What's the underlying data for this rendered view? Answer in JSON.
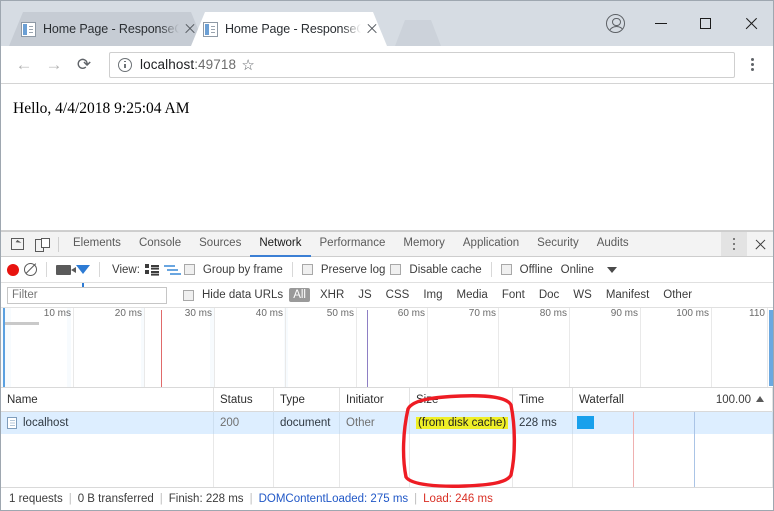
{
  "browser": {
    "tabs": [
      {
        "title": "Home Page - ResponseC",
        "active": false
      },
      {
        "title": "Home Page - ResponseC",
        "active": true
      }
    ],
    "window_controls": {
      "profile": "profile-avatar",
      "minimize": "—",
      "maximize": "□",
      "close": "✕"
    },
    "nav": {
      "back": "←",
      "forward": "→",
      "reload": "⟳",
      "bookmark": "☆"
    },
    "address": {
      "host": "localhost",
      "port": ":49718"
    }
  },
  "page": {
    "content": "Hello, 4/4/2018 9:25:04 AM"
  },
  "devtools": {
    "tabs": [
      {
        "label": "Elements",
        "active": false
      },
      {
        "label": "Console",
        "active": false
      },
      {
        "label": "Sources",
        "active": false
      },
      {
        "label": "Network",
        "active": true
      },
      {
        "label": "Performance",
        "active": false
      },
      {
        "label": "Memory",
        "active": false
      },
      {
        "label": "Application",
        "active": false
      },
      {
        "label": "Security",
        "active": false
      },
      {
        "label": "Audits",
        "active": false
      }
    ],
    "toolbar": {
      "view_label": "View:",
      "group_by_frame": "Group by frame",
      "preserve_log": "Preserve log",
      "disable_cache": "Disable cache",
      "offline": "Offline",
      "throttling": "Online"
    },
    "filterbar": {
      "filter_placeholder": "Filter",
      "hide_data_urls": "Hide data URLs",
      "types": [
        "All",
        "XHR",
        "JS",
        "CSS",
        "Img",
        "Media",
        "Font",
        "Doc",
        "WS",
        "Manifest",
        "Other"
      ],
      "selected_type": "All"
    },
    "overview": {
      "ticks": [
        "10 ms",
        "20 ms",
        "30 ms",
        "40 ms",
        "50 ms",
        "60 ms",
        "70 ms",
        "80 ms",
        "90 ms",
        "100 ms",
        "110"
      ]
    },
    "table": {
      "columns": [
        "Name",
        "Status",
        "Type",
        "Initiator",
        "Size",
        "Time",
        "Waterfall"
      ],
      "waterfall_scale": "100.00",
      "rows": [
        {
          "name": "localhost",
          "status": "200",
          "type": "document",
          "initiator": "Other",
          "size": "(from disk cache)",
          "size_highlighted": true,
          "time": "228 ms"
        }
      ]
    },
    "status": {
      "requests": "1 requests",
      "transferred": "0 B transferred",
      "finish": "Finish: 228 ms",
      "dom_content_loaded": "DOMContentLoaded: 275 ms",
      "load": "Load: 246 ms"
    }
  },
  "annotation": {
    "shape": "red-hand-drawn-ellipse",
    "color": "#ee1c24",
    "target": "size-column"
  }
}
